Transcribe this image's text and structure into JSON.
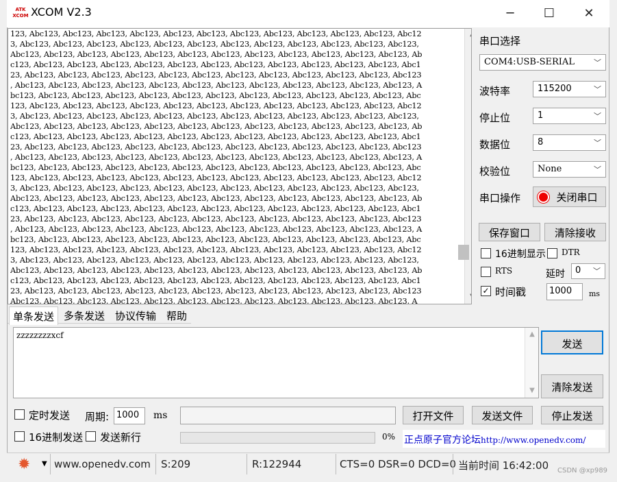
{
  "window": {
    "title": "XCOM V2.3",
    "logo_text": "ATK XCOM",
    "minimize_icon": "─",
    "maximize_icon": "☐",
    "close_icon": "✕"
  },
  "receive": {
    "lines": [
      "123, Abc123, Abc123, Abc123, Abc123, Abc123, Abc123, Abc123, Abc123, Abc123, Abc123, Abc123, Abc12",
      "3, Abc123, Abc123, Abc123, Abc123, Abc123, Abc123, Abc123, Abc123, Abc123, Abc123, Abc123, Abc123,",
      "Abc123, Abc123, Abc123, Abc123, Abc123, Abc123, Abc123, Abc123, Abc123, Abc123, Abc123, Abc123, Ab",
      "c123, Abc123, Abc123, Abc123, Abc123, Abc123, Abc123, Abc123, Abc123, Abc123, Abc123, Abc123, Abc1",
      "23, Abc123, Abc123, Abc123, Abc123, Abc123, Abc123, Abc123, Abc123, Abc123, Abc123, Abc123, Abc123",
      ", Abc123, Abc123, Abc123, Abc123, Abc123, Abc123, Abc123, Abc123, Abc123, Abc123, Abc123, Abc123, A",
      "bc123, Abc123, Abc123, Abc123, Abc123, Abc123, Abc123, Abc123, Abc123, Abc123, Abc123, Abc123, Abc",
      "123, Abc123, Abc123, Abc123, Abc123, Abc123, Abc123, Abc123, Abc123, Abc123, Abc123, Abc123, Abc12",
      "3, Abc123, Abc123, Abc123, Abc123, Abc123, Abc123, Abc123, Abc123, Abc123, Abc123, Abc123, Abc123,",
      "Abc123, Abc123, Abc123, Abc123, Abc123, Abc123, Abc123, Abc123, Abc123, Abc123, Abc123, Abc123, Ab",
      "c123, Abc123, Abc123, Abc123, Abc123, Abc123, Abc123, Abc123, Abc123, Abc123, Abc123, Abc123, Abc1",
      "23, Abc123, Abc123, Abc123, Abc123, Abc123, Abc123, Abc123, Abc123, Abc123, Abc123, Abc123, Abc123",
      ", Abc123, Abc123, Abc123, Abc123, Abc123, Abc123, Abc123, Abc123, Abc123, Abc123, Abc123, Abc123, A",
      "bc123, Abc123, Abc123, Abc123, Abc123, Abc123, Abc123, Abc123, Abc123, Abc123, Abc123, Abc123, Abc",
      "123, Abc123, Abc123, Abc123, Abc123, Abc123, Abc123, Abc123, Abc123, Abc123, Abc123, Abc123, Abc12",
      "3, Abc123, Abc123, Abc123, Abc123, Abc123, Abc123, Abc123, Abc123, Abc123, Abc123, Abc123, Abc123,",
      "Abc123, Abc123, Abc123, Abc123, Abc123, Abc123, Abc123, Abc123, Abc123, Abc123, Abc123, Abc123, Ab",
      "c123, Abc123, Abc123, Abc123, Abc123, Abc123, Abc123, Abc123, Abc123, Abc123, Abc123, Abc123, Abc1",
      "23, Abc123, Abc123, Abc123, Abc123, Abc123, Abc123, Abc123, Abc123, Abc123, Abc123, Abc123, Abc123",
      ", Abc123, Abc123, Abc123, Abc123, Abc123, Abc123, Abc123, Abc123, Abc123, Abc123, Abc123, Abc123, A",
      "bc123, Abc123, Abc123, Abc123, Abc123, Abc123, Abc123, Abc123, Abc123, Abc123, Abc123, Abc123, Abc",
      "123, Abc123, Abc123, Abc123, Abc123, Abc123, Abc123, Abc123, Abc123, Abc123, Abc123, Abc123, Abc12",
      "3, Abc123, Abc123, Abc123, Abc123, Abc123, Abc123, Abc123, Abc123, Abc123, Abc123, Abc123, Abc123,",
      "Abc123, Abc123, Abc123, Abc123, Abc123, Abc123, Abc123, Abc123, Abc123, Abc123, Abc123, Abc123, Ab",
      "c123, Abc123, Abc123, Abc123, Abc123, Abc123, Abc123, Abc123, Abc123, Abc123, Abc123, Abc123, Abc1",
      "23, Abc123, Abc123, Abc123, Abc123, Abc123, Abc123, Abc123, Abc123, Abc123, Abc123, Abc123, Abc123",
      "Abc123, Abc123, Abc123, Abc123, Abc123, Abc123, Abc123, Abc123, Abc123, Abc123, Abc123, Abc123, A"
    ]
  },
  "settings": {
    "port_select_label": "串口选择",
    "port_value": "COM4:USB-SERIAL",
    "baud_label": "波特率",
    "baud_value": "115200",
    "stop_label": "停止位",
    "stop_value": "1",
    "data_label": "数据位",
    "data_value": "8",
    "parity_label": "校验位",
    "parity_value": "None",
    "port_op_label": "串口操作",
    "close_port_button": "关闭串口",
    "save_window_button": "保存窗口",
    "clear_receive_button": "清除接收",
    "hex_display_label": "16进制显示",
    "dtr_label": "DTR",
    "rts_label": "RTS",
    "delay_label": "延时",
    "delay_value": "0",
    "timestamp_label": "时间戳",
    "timestamp_value": "1000",
    "ms_unit": "ms",
    "hex_display_checked": false,
    "dtr_checked": false,
    "rts_checked": false,
    "timestamp_checked": true
  },
  "tabs": [
    "单条发送",
    "多条发送",
    "协议传输",
    "帮助"
  ],
  "send": {
    "text": "zzzzzzzzxcf",
    "send_button": "发送",
    "clear_send_button": "清除发送",
    "timed_send_label": "定时发送",
    "period_label": "周期:",
    "period_value": "1000",
    "period_unit": "ms",
    "open_file_button": "打开文件",
    "send_file_button": "发送文件",
    "stop_send_button": "停止发送",
    "hex_send_label": "16进制发送",
    "send_newline_label": "发送新行",
    "progress_text": "0%",
    "progress": 0,
    "link_text": "正点原子官方论坛",
    "link_url_text": "http://www.openedv.com/"
  },
  "status": {
    "website": "www.openedv.com",
    "sent": "S:209",
    "received": "R:122944",
    "signals": "CTS=0 DSR=0 DCD=0",
    "time": "当前时间 16:42:00",
    "watermark": "CSDN @xp989"
  }
}
